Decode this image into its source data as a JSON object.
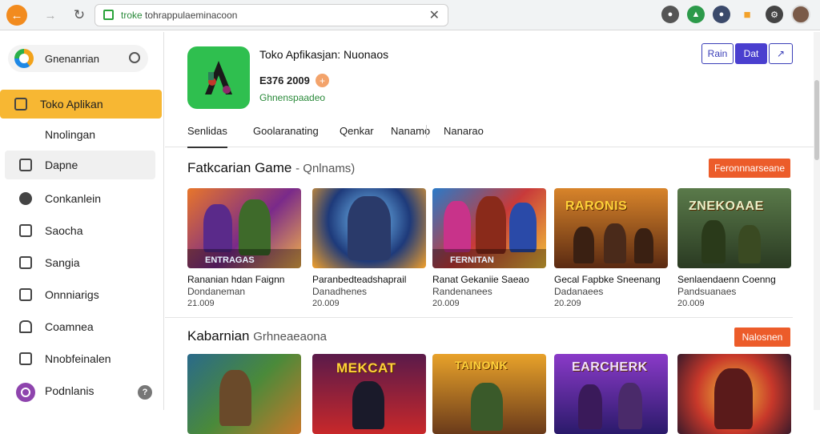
{
  "browser": {
    "url_site": "troke",
    "url_rest": " tohrappulaeminacoon"
  },
  "sidebar": {
    "search_label": "Gnenanrian",
    "items": [
      {
        "label": "Toko Aplikan"
      },
      {
        "label": "Nnolingan"
      },
      {
        "label": "Dapne"
      },
      {
        "label": "Conkanlein"
      },
      {
        "label": "Saocha"
      },
      {
        "label": "Sangia"
      },
      {
        "label": "Onnniarigs"
      },
      {
        "label": "Coamnea"
      },
      {
        "label": "Nnobfeinalen"
      },
      {
        "label": "Podnlanis"
      }
    ],
    "help": "?"
  },
  "app": {
    "title": "Toko Apfikasjan: Nuonaos",
    "rating": "E376 2009",
    "rating_badge": "+",
    "developer": "Ghnenspaadeo",
    "btn_outline": "Rain",
    "btn_primary": "Dat",
    "btn_share": "↗"
  },
  "tabs": [
    "Senlidas",
    "Goolaranating",
    "Qenkar",
    "Nanamo",
    "Nanarao"
  ],
  "sections": [
    {
      "title": "Fatkcarian Game",
      "subtitle": "- Qnlnams)",
      "button": "Feronnnarseane",
      "cards": [
        {
          "banner": "",
          "footer": "ENTRAGAS",
          "title": "Rananian hdan Faignn",
          "sub": "Dondaneman",
          "price": "21.009"
        },
        {
          "banner": "",
          "footer": "",
          "title": "Paranbedteadshaprail",
          "sub": "Danadhenes",
          "price": "20.009"
        },
        {
          "banner": "",
          "footer": "FERNITAN",
          "title": "Ranat Gekaniie Saeao",
          "sub": "Randenanees",
          "price": "20.009"
        },
        {
          "banner": "RARONIS",
          "footer": "",
          "title": "Gecal Fapbke Sneenang",
          "sub": "Dadanaees",
          "price": "20.209"
        },
        {
          "banner": "ZNEKOAAE",
          "footer": "",
          "title": "Senlaendaenn Coenng",
          "sub": "Pandsuanaes",
          "price": "20.009"
        }
      ]
    },
    {
      "title": "Kabarnian",
      "subtitle": "Grhneaeaona",
      "button": "Nalosnen",
      "cards": [
        {
          "banner": "",
          "footer": ""
        },
        {
          "banner": "MEKCAT",
          "footer": ""
        },
        {
          "banner": "TAINONK",
          "footer": ""
        },
        {
          "banner": "EARCHERK",
          "footer": ""
        },
        {
          "banner": "",
          "footer": ""
        }
      ]
    }
  ]
}
